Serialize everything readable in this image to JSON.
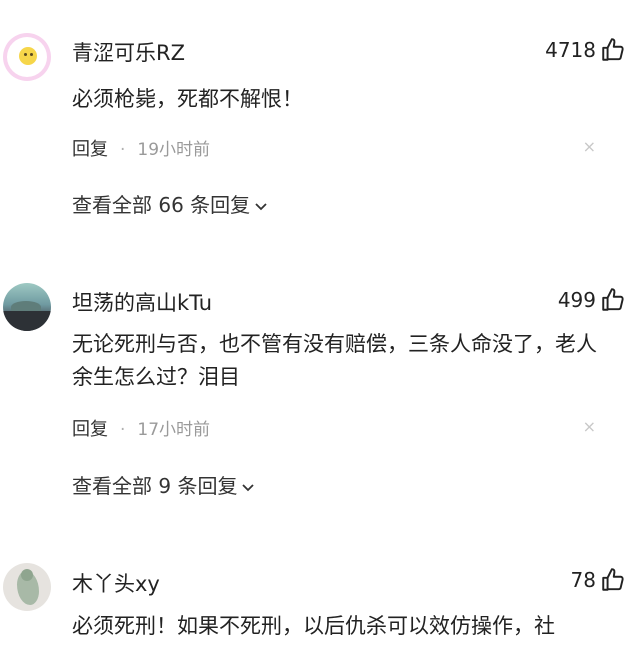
{
  "comments": [
    {
      "username": "青涩可乐RZ",
      "likes": "4718",
      "text": "必须枪毙，死都不解恨！",
      "reply_label": "回复",
      "time": "19小时前",
      "view_replies": "查看全部 66 条回复",
      "close_symbol": "×"
    },
    {
      "username": "坦荡的高山kTu",
      "likes": "499",
      "text": "无论死刑与否，也不管有没有赔偿，三条人命没了，老人余生怎么过？泪目",
      "reply_label": "回复",
      "time": "17小时前",
      "view_replies": "查看全部 9 条回复",
      "close_symbol": "×"
    },
    {
      "username": "木丫头xy",
      "likes": "78",
      "text": "必须死刑！如果不死刑，以后仇杀可以效仿操作，社"
    }
  ],
  "separator": "·",
  "icons": {
    "like": "thumbs-up-icon",
    "expand": "chevron-down-icon",
    "close": "close-icon"
  }
}
